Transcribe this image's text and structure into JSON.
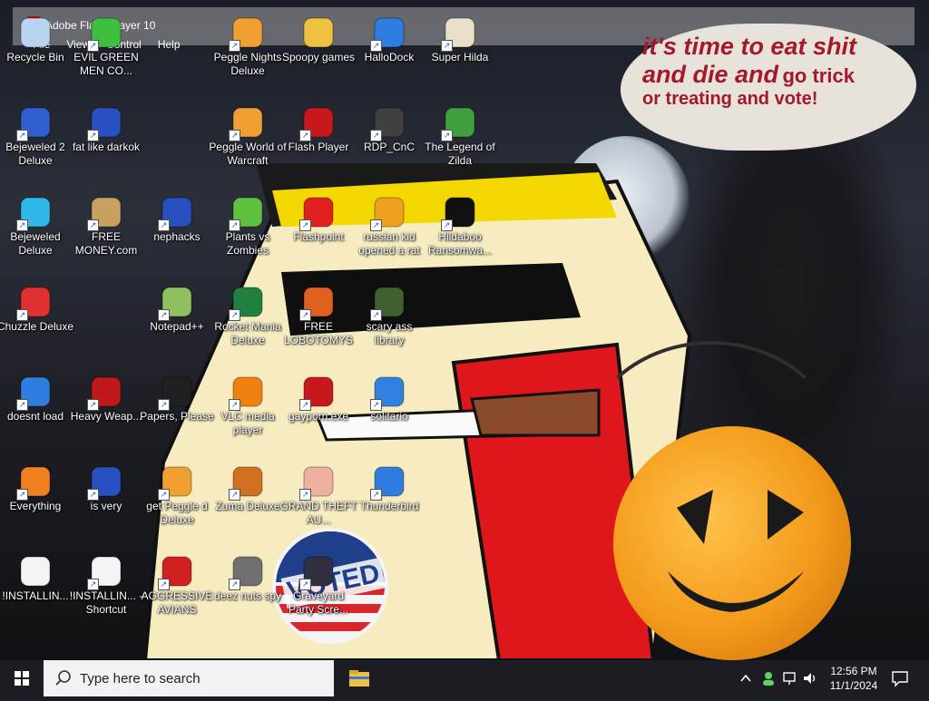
{
  "window": {
    "title": "Adobe Flash Player 10",
    "menu": [
      "File",
      "View",
      "Control",
      "Help"
    ]
  },
  "speech_bubble": {
    "line1": "it's time to eat shit",
    "line2a": "and die and",
    "line2b": "go trick",
    "line3": "or treating and vote!"
  },
  "sticker": {
    "text": "VOTED"
  },
  "desktop_icons": [
    {
      "label": "Recycle Bin",
      "icon": "recycle-bin-icon",
      "shortcut": false
    },
    {
      "label": "EVIL GREEN MEN CO...",
      "icon": "alien-icon",
      "shortcut": true
    },
    {
      "label": "Peggle Nights Deluxe",
      "icon": "peggle-icon",
      "shortcut": true
    },
    {
      "label": "Spoopy games",
      "icon": "folder-icon",
      "shortcut": false
    },
    {
      "label": "HalloDock",
      "icon": "windows-icon",
      "shortcut": true
    },
    {
      "label": "Super Hilda",
      "icon": "game-icon",
      "shortcut": true
    },
    {
      "label": "Bejeweled 2 Deluxe",
      "icon": "bejeweled2-icon",
      "shortcut": true
    },
    {
      "label": "fat like darkok",
      "icon": "mpi-icon",
      "shortcut": true
    },
    {
      "label": "Peggle World of Warcraft",
      "icon": "peggle-icon",
      "shortcut": true
    },
    {
      "label": "Flash Player",
      "icon": "flash-icon",
      "shortcut": true
    },
    {
      "label": "RDP_CnC",
      "icon": "rdp-icon",
      "shortcut": true
    },
    {
      "label": "The Legend of Zilda",
      "icon": "zelda-icon",
      "shortcut": true
    },
    {
      "label": "Bejeweled Deluxe",
      "icon": "gem-icon",
      "shortcut": true
    },
    {
      "label": "FREE MONEY.com",
      "icon": "money-bag-icon",
      "shortcut": true
    },
    {
      "label": "nephacks",
      "icon": "mpi-icon",
      "shortcut": true
    },
    {
      "label": "Plants vs Zombies",
      "icon": "plant-icon",
      "shortcut": true
    },
    {
      "label": "Flashpoint",
      "icon": "flashpoint-icon",
      "shortcut": true
    },
    {
      "label": "russian kid opened a rat",
      "icon": "de-icon",
      "shortcut": true
    },
    {
      "label": "Hildaboo Ransomwa...",
      "icon": "yashma-icon",
      "shortcut": true
    },
    {
      "label": "Chuzzle Deluxe",
      "icon": "chuzzle-icon",
      "shortcut": true
    },
    {
      "label": "Notepad++",
      "icon": "notepad-icon",
      "shortcut": true
    },
    {
      "label": "Rocket Mania Deluxe",
      "icon": "rocket-icon",
      "shortcut": true
    },
    {
      "label": "FREE LOBOTOMYS",
      "icon": "gauge-icon",
      "shortcut": true
    },
    {
      "label": "scary ass library",
      "icon": "library-icon",
      "shortcut": true
    },
    {
      "label": "doesnt load",
      "icon": "thunderbird-icon",
      "shortcut": true
    },
    {
      "label": "Heavy Weap...",
      "icon": "radiation-icon",
      "shortcut": true
    },
    {
      "label": "Papers, Please",
      "icon": "papers-icon",
      "shortcut": true
    },
    {
      "label": "VLC media player",
      "icon": "vlc-icon",
      "shortcut": true
    },
    {
      "label": "gayporn.exe",
      "icon": "flash-icon",
      "shortcut": true
    },
    {
      "label": "solitario",
      "icon": "solitaire-icon",
      "shortcut": true
    },
    {
      "label": "Everything",
      "icon": "search-everything-icon",
      "shortcut": true
    },
    {
      "label": "is very",
      "icon": "mpi-icon",
      "shortcut": true
    },
    {
      "label": "get Peggle d Deluxe",
      "icon": "peggle-icon",
      "shortcut": true
    },
    {
      "label": "Zuma Deluxe",
      "icon": "zuma-icon",
      "shortcut": true
    },
    {
      "label": "GRAND THEFT AU...",
      "icon": "anime-girl-icon",
      "shortcut": true
    },
    {
      "label": "Thunderbird",
      "icon": "thunderbird-icon",
      "shortcut": true
    },
    {
      "label": "!INSTALLIN...",
      "icon": "document-icon",
      "shortcut": false
    },
    {
      "label": "!INSTALLIN... - Shortcut",
      "icon": "document-icon",
      "shortcut": true
    },
    {
      "label": "AGGRESSIVE AVIANS",
      "icon": "angry-bird-icon",
      "shortcut": true
    },
    {
      "label": "deez nuts spy",
      "icon": "windows-stack-icon",
      "shortcut": true
    },
    {
      "label": "Graveyard Party Scre...",
      "icon": "graveyard-icon",
      "shortcut": true
    }
  ],
  "taskbar": {
    "search_placeholder": "Type here to search",
    "time": "12:56 PM",
    "date": "11/1/2024"
  },
  "colors": {
    "taskbar": "#1c1c22",
    "accent": "#0078d7",
    "bubble_text": "#a3182b"
  }
}
